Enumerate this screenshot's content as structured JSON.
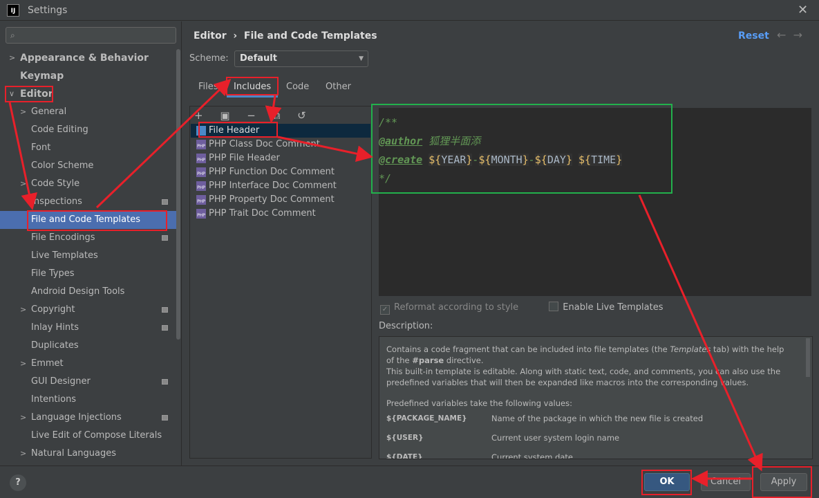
{
  "window": {
    "title": "Settings",
    "logo": "IJ"
  },
  "sidebar": {
    "search_placeholder": "",
    "items": [
      {
        "label": "Appearance & Behavior",
        "level": 0,
        "chev": "›",
        "bold": true
      },
      {
        "label": "Keymap",
        "level": 0,
        "bold": true
      },
      {
        "label": "Editor",
        "level": 0,
        "chev": "⌄",
        "bold": true
      },
      {
        "label": "General",
        "level": 1,
        "chev": "›"
      },
      {
        "label": "Code Editing",
        "level": 1
      },
      {
        "label": "Font",
        "level": 1
      },
      {
        "label": "Color Scheme",
        "level": 1
      },
      {
        "label": "Code Style",
        "level": 1,
        "chev": "›"
      },
      {
        "label": "Inspections",
        "level": 1,
        "icon": true
      },
      {
        "label": "File and Code Templates",
        "level": 1,
        "selected": true
      },
      {
        "label": "File Encodings",
        "level": 1,
        "icon": true
      },
      {
        "label": "Live Templates",
        "level": 1
      },
      {
        "label": "File Types",
        "level": 1
      },
      {
        "label": "Android Design Tools",
        "level": 1
      },
      {
        "label": "Copyright",
        "level": 1,
        "chev": "›",
        "icon": true
      },
      {
        "label": "Inlay Hints",
        "level": 1,
        "icon": true
      },
      {
        "label": "Duplicates",
        "level": 1
      },
      {
        "label": "Emmet",
        "level": 1,
        "chev": "›"
      },
      {
        "label": "GUI Designer",
        "level": 1,
        "icon": true
      },
      {
        "label": "Intentions",
        "level": 1
      },
      {
        "label": "Language Injections",
        "level": 1,
        "chev": "›",
        "icon": true
      },
      {
        "label": "Live Edit of Compose Literals",
        "level": 1
      },
      {
        "label": "Natural Languages",
        "level": 1,
        "chev": "›"
      }
    ]
  },
  "header": {
    "crumb_parent": "Editor",
    "crumb_sep": "›",
    "crumb_current": "File and Code Templates",
    "reset": "Reset",
    "back": "←",
    "forward": "→"
  },
  "scheme": {
    "label": "Scheme:",
    "value": "Default"
  },
  "tabs": [
    "Files",
    "Includes",
    "Code",
    "Other"
  ],
  "toolbar": "+ ▣ − ⧉ ↺",
  "templates": [
    "File Header",
    "PHP Class Doc Comment",
    "PHP File Header",
    "PHP Function Doc Comment",
    "PHP Interface Doc Comment",
    "PHP Property Doc Comment",
    "PHP Trait Doc Comment"
  ],
  "editor": {
    "l1": "/**",
    "author_tag": "@author",
    "author_name": "狐狸半面添",
    "create_tag": "@create",
    "v1": "YEAR",
    "v2": "MONTH",
    "v3": "DAY",
    "v4": "TIME",
    "l4": "*/"
  },
  "options": {
    "reformat": "Reformat according to style",
    "live": "Enable Live Templates"
  },
  "description": {
    "label": "Description:",
    "p1a": "Contains a code fragment that can be included into file templates (the ",
    "p1i": "Templates",
    "p1b": " tab) with the help of the ",
    "p1c": "#parse",
    "p1d": " directive.",
    "p2": "This built-in template is editable. Along with static text, code, and comments, you can also use the predefined variables that will then be expanded like macros into the corresponding values.",
    "p3": "Predefined variables take the following values:",
    "vars": [
      {
        "name": "${PACKAGE_NAME}",
        "desc": "Name of the package in which the new file is created"
      },
      {
        "name": "${USER}",
        "desc": "Current user system login name"
      },
      {
        "name": "${DATE}",
        "desc": "Current system date"
      }
    ]
  },
  "buttons": {
    "help": "?",
    "ok": "OK",
    "cancel": "Cancel",
    "apply": "Apply"
  },
  "colors": {
    "annotation_red": "#e8202a",
    "annotation_green": "#22b14c",
    "accent": "#4b6eaf"
  }
}
